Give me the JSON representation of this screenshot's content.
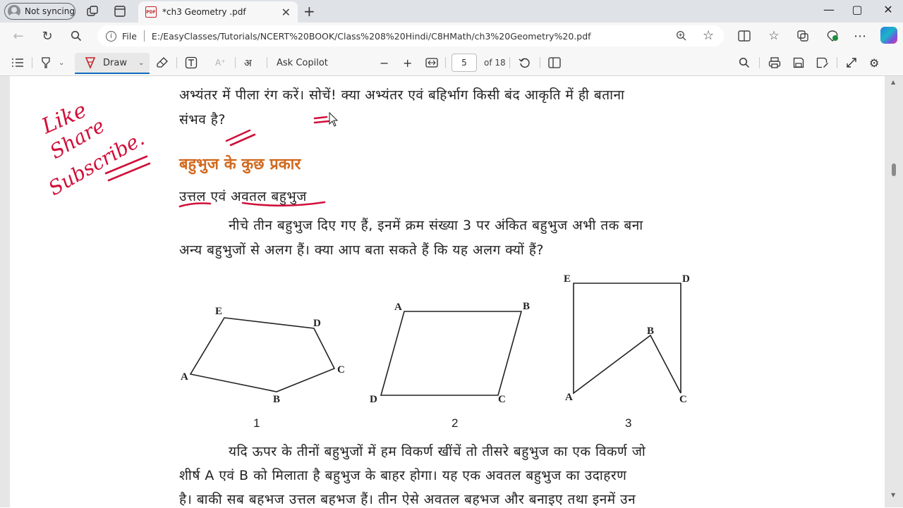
{
  "browser": {
    "profile_label": "Not syncing",
    "tab_title": "*ch3 Geometry .pdf",
    "tab_favicon_label": "PDF",
    "address_prefix": "File",
    "url": "E:/EasyClasses/Tutorials/NCERT%20BOOK/Class%208%20Hindi/C8HMath/ch3%20Geometry%20.pdf",
    "window_buttons": [
      "—",
      "▢",
      "✕"
    ]
  },
  "pdf_toolbar": {
    "draw_label": "Draw",
    "ask_copilot": "Ask Copilot",
    "read_aloud_glyph": "अ",
    "minus": "−",
    "plus": "+",
    "page_number": "5",
    "page_total": "of 18"
  },
  "document": {
    "line1": "अभ्यंतर में पीला रंग करें। सोचें! क्या अभ्यंतर एवं बहिर्भाग किसी बंद आकृति में ही बताना",
    "line2": "संभव है?",
    "heading": "बहुभुज के कुछ प्रकार",
    "subheading": "उत्तल एवं अवतल बहुभुज",
    "para1_line1": "नीचे तीन बहुभुज दिए गए हैं, इनमें क्रम संख्या 3 पर अंकित बहुभुज अभी तक बना",
    "para1_line2": "अन्य बहुभुजों से अलग हैं। क्या आप बता सकते हैं कि यह अलग क्यों हैं?",
    "para2_line1": "यदि ऊपर के तीनों बहुभुजों में हम विकर्ण खींचें तो तीसरे बहुभुज का एक विकर्ण जो",
    "para2_line2": "शीर्ष A एवं B को मिलाता है बहुभुज के बाहर होगा। यह एक अवतल बहुभुज का उदाहरण",
    "para2_line3": "है। बाकी सब बहभज उत्तल बहभज हैं। तीन ऐसे अवतल बहभज और बनाइए तथा इनमें उन"
  },
  "figures": {
    "fig1": {
      "number": "1",
      "labels": [
        "E",
        "D",
        "C",
        "B",
        "A"
      ]
    },
    "fig2": {
      "number": "2",
      "labels": [
        "A",
        "B",
        "C",
        "D"
      ]
    },
    "fig3": {
      "number": "3",
      "labels": [
        "E",
        "D",
        "B",
        "A",
        "C"
      ]
    }
  },
  "annotations": {
    "handwriting": [
      "Like",
      "Share",
      "Subscribe."
    ],
    "ink_color": "#d0103a"
  }
}
